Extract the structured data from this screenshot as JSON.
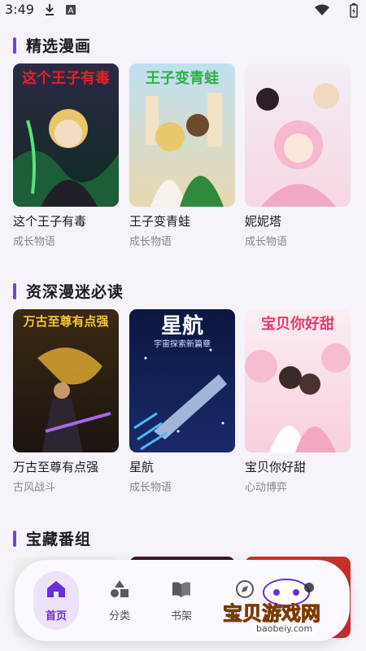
{
  "status_bar": {
    "time": "3:49"
  },
  "sections": [
    {
      "title": "精选漫画",
      "items": [
        {
          "title": "这个王子有毒",
          "tag": "成长物语",
          "cover_text": "这个王子有毒"
        },
        {
          "title": "王子变青蛙",
          "tag": "成长物语",
          "cover_text": "王子变青蛙"
        },
        {
          "title": "妮妮塔",
          "tag": "成长物语",
          "cover_text": ""
        }
      ]
    },
    {
      "title": "资深漫迷必读",
      "items": [
        {
          "title": "万古至尊有点强",
          "tag": "古风战斗",
          "cover_text": "万古至尊有点强"
        },
        {
          "title": "星航",
          "tag": "成长物语",
          "cover_text": "星航",
          "cover_subtext": "宇宙探索新篇章"
        },
        {
          "title": "宝贝你好甜",
          "tag": "心动博弈",
          "cover_text": "宝贝你好甜"
        }
      ]
    },
    {
      "title": "宝藏番组"
    }
  ],
  "nav": {
    "items": [
      {
        "label": "首页",
        "icon": "home-icon",
        "active": true
      },
      {
        "label": "分类",
        "icon": "category-icon",
        "active": false
      },
      {
        "label": "书架",
        "icon": "bookshelf-icon",
        "active": false
      },
      {
        "label": "典",
        "icon": "compass-icon",
        "active": false
      }
    ]
  },
  "watermark": {
    "text": "宝贝游戏网",
    "url": "baobeiy.com"
  },
  "colors": {
    "accent": "#7a3fe4",
    "background": "#f6f3fa",
    "watermark": "#f2a900"
  }
}
